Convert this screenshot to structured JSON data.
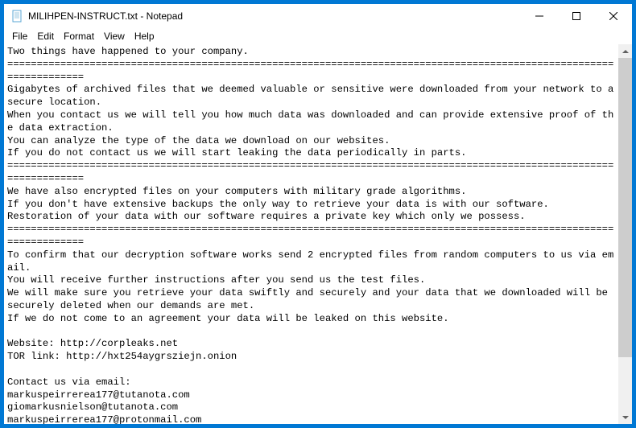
{
  "window": {
    "title": "MILIHPEN-INSTRUCT.txt - Notepad"
  },
  "menu": {
    "file": "File",
    "edit": "Edit",
    "format": "Format",
    "view": "View",
    "help": "Help"
  },
  "document": {
    "text": "Two things have happened to your company.\n====================================================================================================================\nGigabytes of archived files that we deemed valuable or sensitive were downloaded from your network to a secure location.\nWhen you contact us we will tell you how much data was downloaded and can provide extensive proof of the data extraction.\nYou can analyze the type of the data we download on our websites.\nIf you do not contact us we will start leaking the data periodically in parts.\n====================================================================================================================\nWe have also encrypted files on your computers with military grade algorithms.\nIf you don't have extensive backups the only way to retrieve your data is with our software.\nRestoration of your data with our software requires a private key which only we possess.\n====================================================================================================================\nTo confirm that our decryption software works send 2 encrypted files from random computers to us via email.\nYou will receive further instructions after you send us the test files.\nWe will make sure you retrieve your data swiftly and securely and your data that we downloaded will be securely deleted when our demands are met.\nIf we do not come to an agreement your data will be leaked on this website.\n\nWebsite: http://corpleaks.net\nTOR link: http://hxt254aygrsziejn.onion\n\nContact us via email:\nmarkuspeirrerea177@tutanota.com\ngiomarkusnielson@tutanota.com\nmarkuspeirrerea177@protonmail.com"
  }
}
